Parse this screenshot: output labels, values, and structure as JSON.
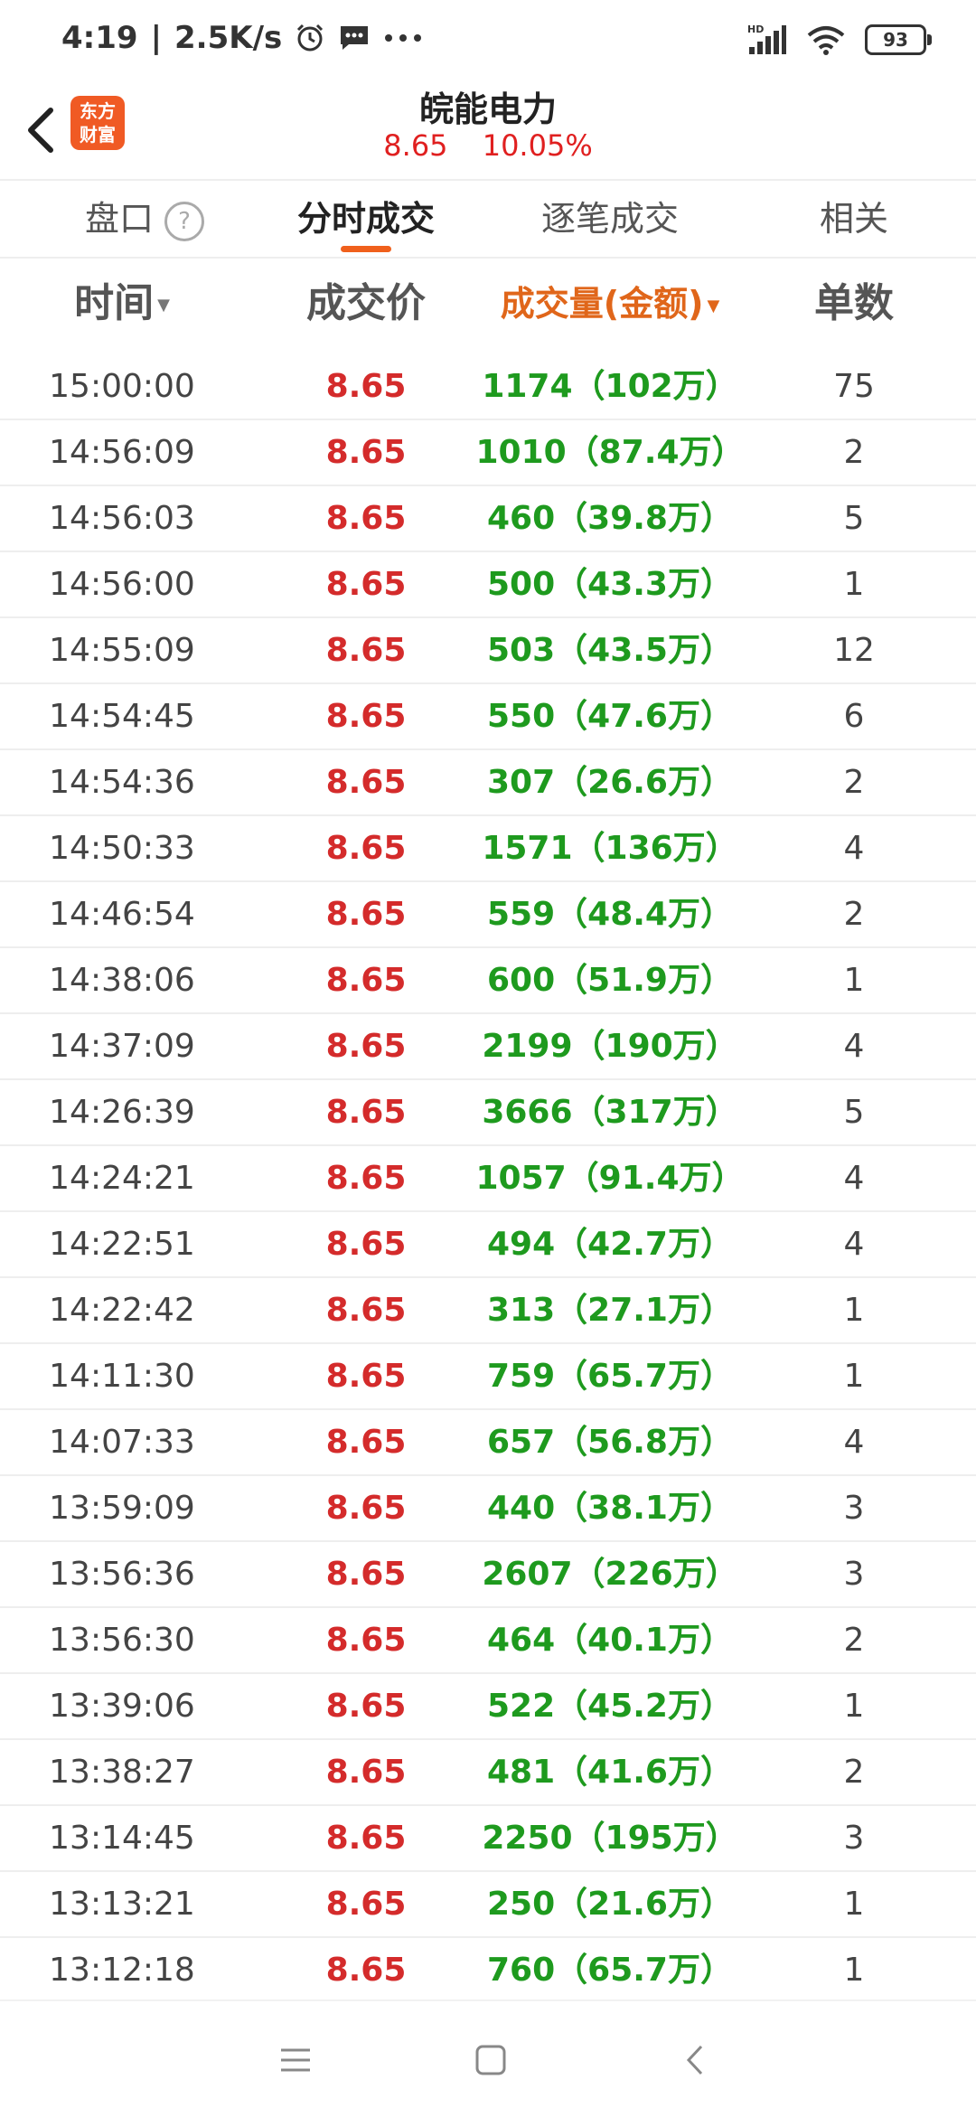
{
  "status": {
    "time": "4:19",
    "speed": "2.5K/s",
    "net_badge": "HD",
    "battery": "93",
    "icons": [
      "alarm-icon",
      "message-icon",
      "more-dots-icon",
      "signal-icon",
      "wifi-icon",
      "battery-icon"
    ]
  },
  "header": {
    "logo_line1": "东方",
    "logo_line2": "财富",
    "title": "皖能电力",
    "price": "8.65",
    "change_pct": "10.05%"
  },
  "tabs": [
    {
      "label": "盘口",
      "active": false
    },
    {
      "label": "分时成交",
      "active": true
    },
    {
      "label": "逐笔成交",
      "active": false
    },
    {
      "label": "相关",
      "active": false
    }
  ],
  "columns": {
    "time": "时间",
    "price": "成交价",
    "volume": "成交量(金额)",
    "count": "单数"
  },
  "colors": {
    "accent": "#f0601c",
    "price_red": "#d42b2b",
    "volume_green": "#1e9a1e"
  },
  "trades": [
    {
      "time": "15:00:00",
      "price": "8.65",
      "volume": "1174（102万）",
      "count": "75"
    },
    {
      "time": "14:56:09",
      "price": "8.65",
      "volume": "1010（87.4万）",
      "count": "2"
    },
    {
      "time": "14:56:03",
      "price": "8.65",
      "volume": "460（39.8万）",
      "count": "5"
    },
    {
      "time": "14:56:00",
      "price": "8.65",
      "volume": "500（43.3万）",
      "count": "1"
    },
    {
      "time": "14:55:09",
      "price": "8.65",
      "volume": "503（43.5万）",
      "count": "12"
    },
    {
      "time": "14:54:45",
      "price": "8.65",
      "volume": "550（47.6万）",
      "count": "6"
    },
    {
      "time": "14:54:36",
      "price": "8.65",
      "volume": "307（26.6万）",
      "count": "2"
    },
    {
      "time": "14:50:33",
      "price": "8.65",
      "volume": "1571（136万）",
      "count": "4"
    },
    {
      "time": "14:46:54",
      "price": "8.65",
      "volume": "559（48.4万）",
      "count": "2"
    },
    {
      "time": "14:38:06",
      "price": "8.65",
      "volume": "600（51.9万）",
      "count": "1"
    },
    {
      "time": "14:37:09",
      "price": "8.65",
      "volume": "2199（190万）",
      "count": "4"
    },
    {
      "time": "14:26:39",
      "price": "8.65",
      "volume": "3666（317万）",
      "count": "5"
    },
    {
      "time": "14:24:21",
      "price": "8.65",
      "volume": "1057（91.4万）",
      "count": "4"
    },
    {
      "time": "14:22:51",
      "price": "8.65",
      "volume": "494（42.7万）",
      "count": "4"
    },
    {
      "time": "14:22:42",
      "price": "8.65",
      "volume": "313（27.1万）",
      "count": "1"
    },
    {
      "time": "14:11:30",
      "price": "8.65",
      "volume": "759（65.7万）",
      "count": "1"
    },
    {
      "time": "14:07:33",
      "price": "8.65",
      "volume": "657（56.8万）",
      "count": "4"
    },
    {
      "time": "13:59:09",
      "price": "8.65",
      "volume": "440（38.1万）",
      "count": "3"
    },
    {
      "time": "13:56:36",
      "price": "8.65",
      "volume": "2607（226万）",
      "count": "3"
    },
    {
      "time": "13:56:30",
      "price": "8.65",
      "volume": "464（40.1万）",
      "count": "2"
    },
    {
      "time": "13:39:06",
      "price": "8.65",
      "volume": "522（45.2万）",
      "count": "1"
    },
    {
      "time": "13:38:27",
      "price": "8.65",
      "volume": "481（41.6万）",
      "count": "2"
    },
    {
      "time": "13:14:45",
      "price": "8.65",
      "volume": "2250（195万）",
      "count": "3"
    },
    {
      "time": "13:13:21",
      "price": "8.65",
      "volume": "250（21.6万）",
      "count": "1"
    },
    {
      "time": "13:12:18",
      "price": "8.65",
      "volume": "760（65.7万）",
      "count": "1"
    }
  ],
  "navbar": {
    "icons": [
      "menu-icon",
      "home-square-icon",
      "back-triangle-icon"
    ]
  }
}
